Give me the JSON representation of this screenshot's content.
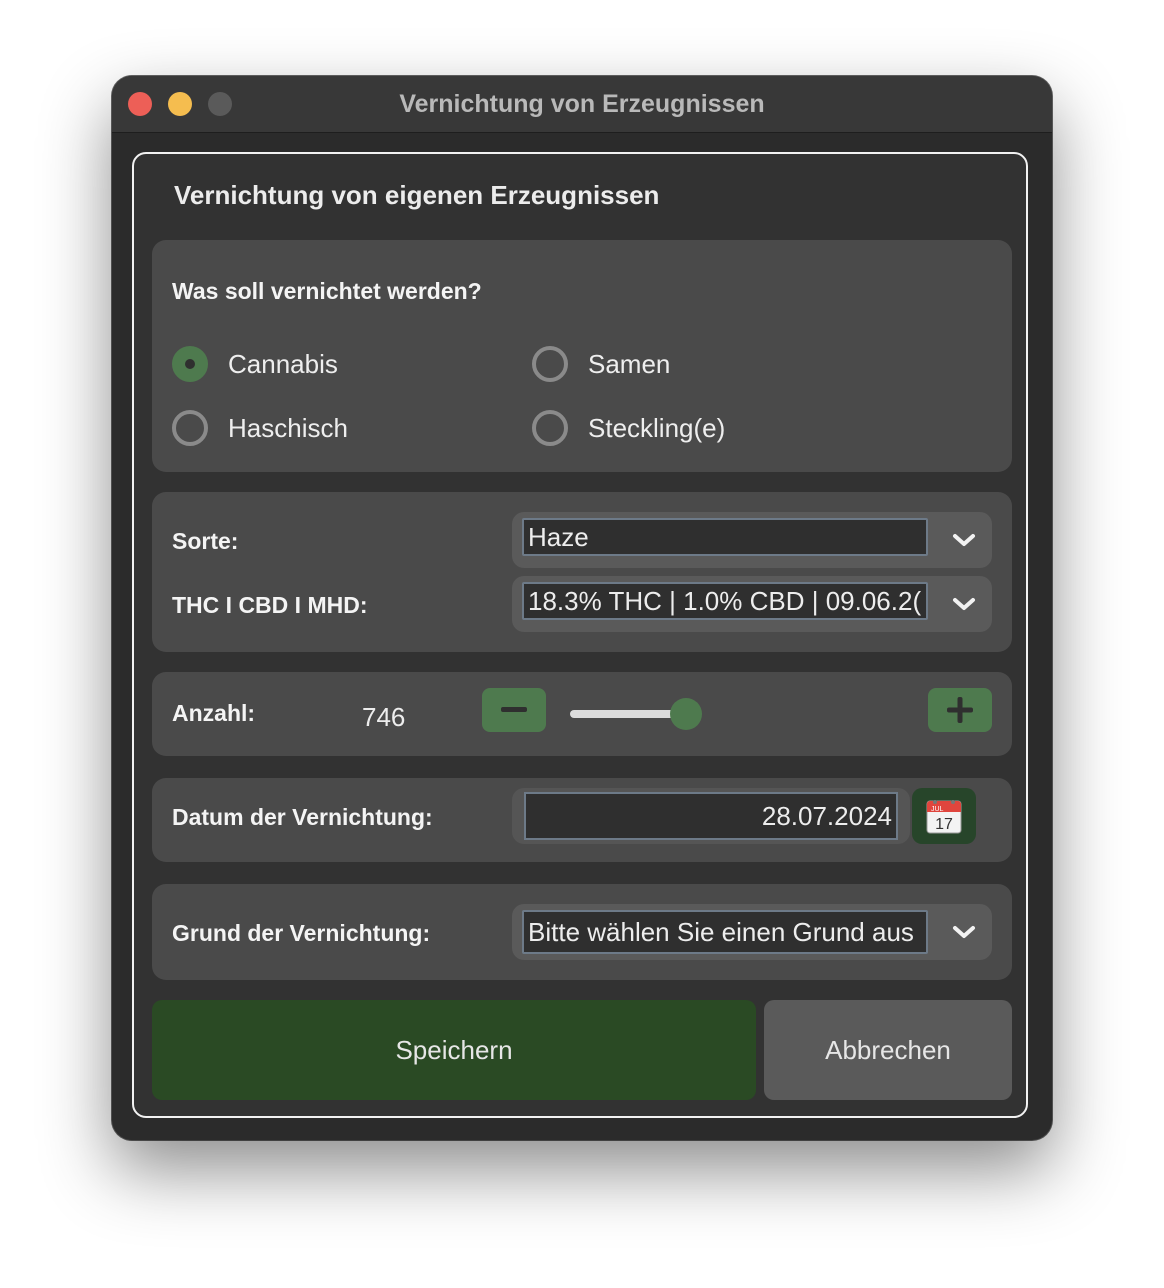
{
  "window": {
    "title": "Vernichtung von Erzeugnissen"
  },
  "form": {
    "heading": "Vernichtung von eigenen Erzeugnissen",
    "what": {
      "label": "Was soll vernichtet werden?",
      "options": [
        {
          "label": "Cannabis",
          "checked": true
        },
        {
          "label": "Samen",
          "checked": false
        },
        {
          "label": "Haschisch",
          "checked": false
        },
        {
          "label": "Steckling(e)",
          "checked": false
        }
      ]
    },
    "sorte": {
      "label": "Sorte:",
      "value": "Haze"
    },
    "thc": {
      "label": "THC I CBD I MHD:",
      "value": "18.3% THC | 1.0% CBD | 09.06.2("
    },
    "anzahl": {
      "label": "Anzahl:",
      "value": "746",
      "slider_fraction": 0.9
    },
    "datum": {
      "label": "Datum der Vernichtung:",
      "value": "28.07.2024",
      "calendar_day": "17",
      "calendar_month": "JUL"
    },
    "grund": {
      "label": "Grund der Vernichtung:",
      "value": "Bitte wählen Sie einen Grund aus"
    },
    "buttons": {
      "save": "Speichern",
      "cancel": "Abbrechen"
    }
  },
  "colors": {
    "accent_green": "#4e7a4e",
    "save_green": "#2a4a24",
    "card_bg": "#4a4a4a",
    "window_bg": "#2b2b2b"
  }
}
